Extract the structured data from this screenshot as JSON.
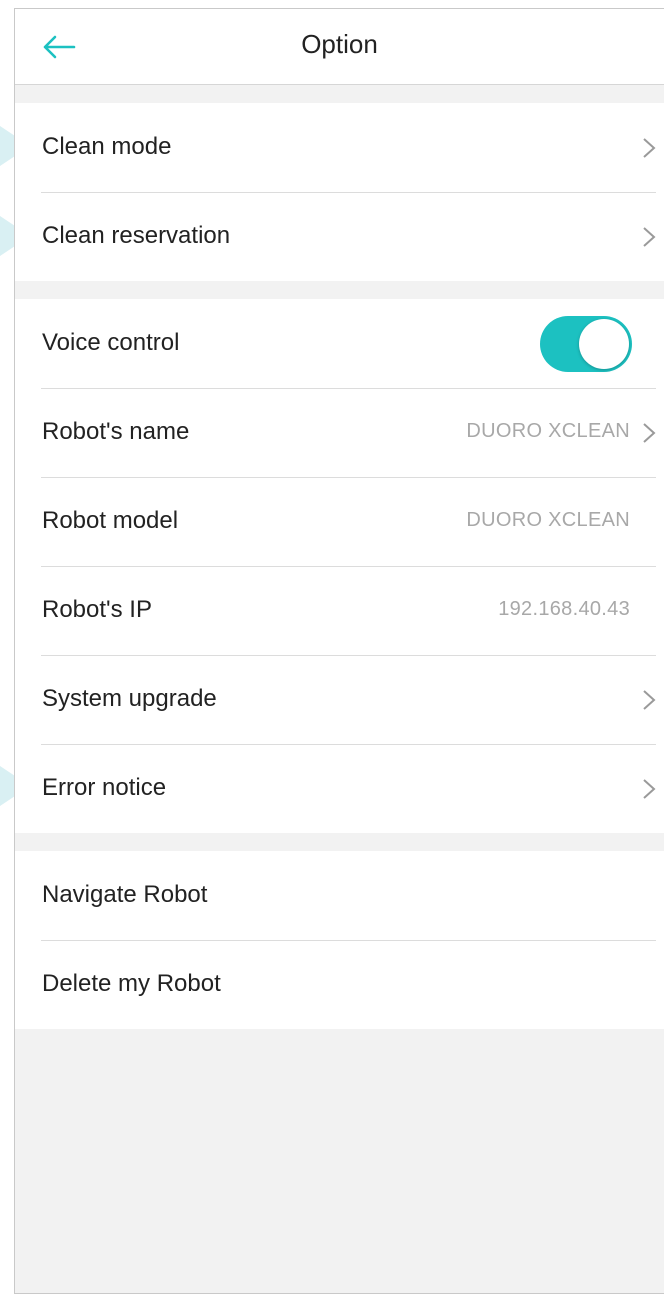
{
  "header": {
    "title": "Option",
    "back_icon": "arrow-left-icon",
    "accent_color": "#1cc1c1"
  },
  "sections": {
    "cleaning": {
      "items": [
        {
          "label": "Clean mode"
        },
        {
          "label": "Clean reservation"
        }
      ]
    },
    "robot": {
      "items": [
        {
          "label": "Voice control",
          "toggle_on": true
        },
        {
          "label": "Robot's name",
          "value": "DUORO XCLEAN"
        },
        {
          "label": "Robot model",
          "value": "DUORO XCLEAN"
        },
        {
          "label": "Robot's IP",
          "value": "192.168.40.43"
        },
        {
          "label": "System upgrade"
        },
        {
          "label": "Error notice"
        }
      ]
    },
    "actions": {
      "items": [
        {
          "label": "Navigate Robot"
        },
        {
          "label": "Delete my Robot"
        }
      ]
    }
  }
}
